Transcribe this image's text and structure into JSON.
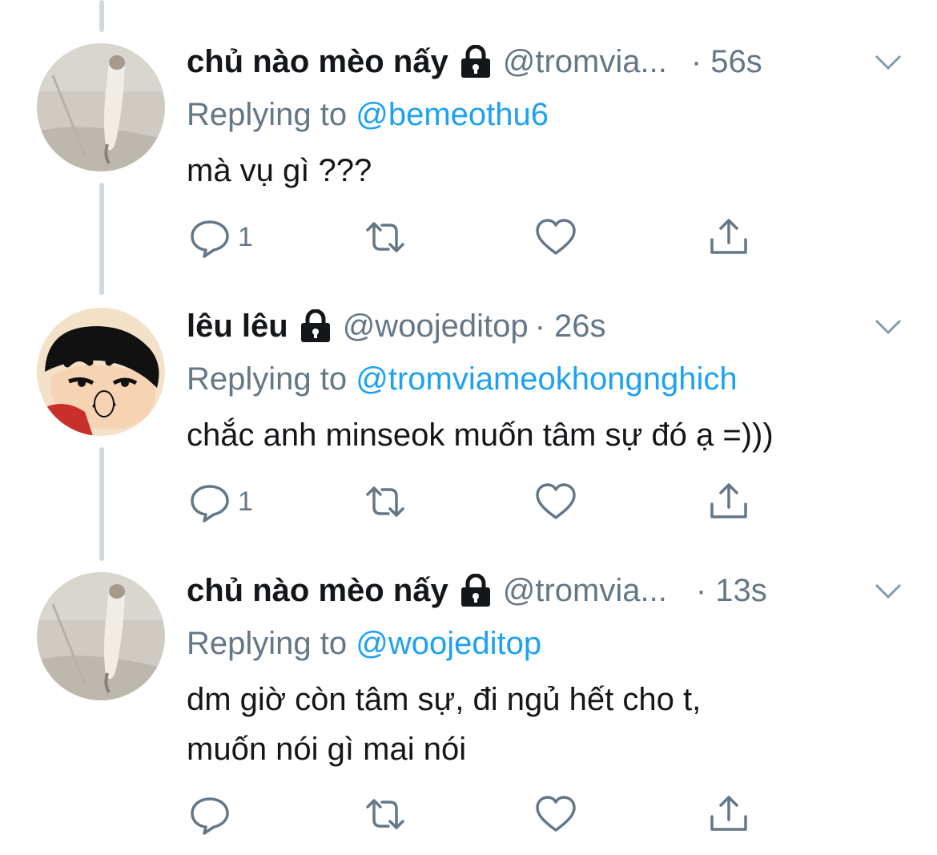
{
  "tweets": [
    {
      "name": "chủ nào mèo nấy",
      "handle": "@tromvia...",
      "time": "· 56s",
      "replying_prefix": "Replying to ",
      "replying_to": "@bemeothu6",
      "text": [
        "mà vụ gì ???"
      ],
      "reply_count": "1",
      "avatar": "cat-photo-avatar"
    },
    {
      "name": "lêu lêu",
      "handle": "@woojeditop",
      "time": "· 26s",
      "replying_prefix": "Replying to ",
      "replying_to": "@tromviameokhongnghich",
      "text": [
        "chắc anh minseok muốn tâm sự đó ạ =)))"
      ],
      "reply_count": "1",
      "avatar": "cartoon-boy-avatar"
    },
    {
      "name": "chủ nào mèo nấy",
      "handle": "@tromvia...",
      "time": "· 13s",
      "replying_prefix": "Replying to ",
      "replying_to": "@woojeditop",
      "text": [
        "dm giờ còn tâm sự, đi ngủ hết cho t,",
        "muốn nói gì mai nói"
      ],
      "reply_count": "",
      "avatar": "cat-photo-avatar"
    }
  ],
  "icons": {
    "lock": "lock-icon",
    "chevron": "chevron-down-icon",
    "reply": "reply-icon",
    "retweet": "retweet-icon",
    "like": "like-icon",
    "share": "share-icon"
  },
  "colors": {
    "link": "#1da1f2",
    "secondary_text": "#657786",
    "primary_text": "#14171a",
    "thread_line": "#cfd9de"
  }
}
